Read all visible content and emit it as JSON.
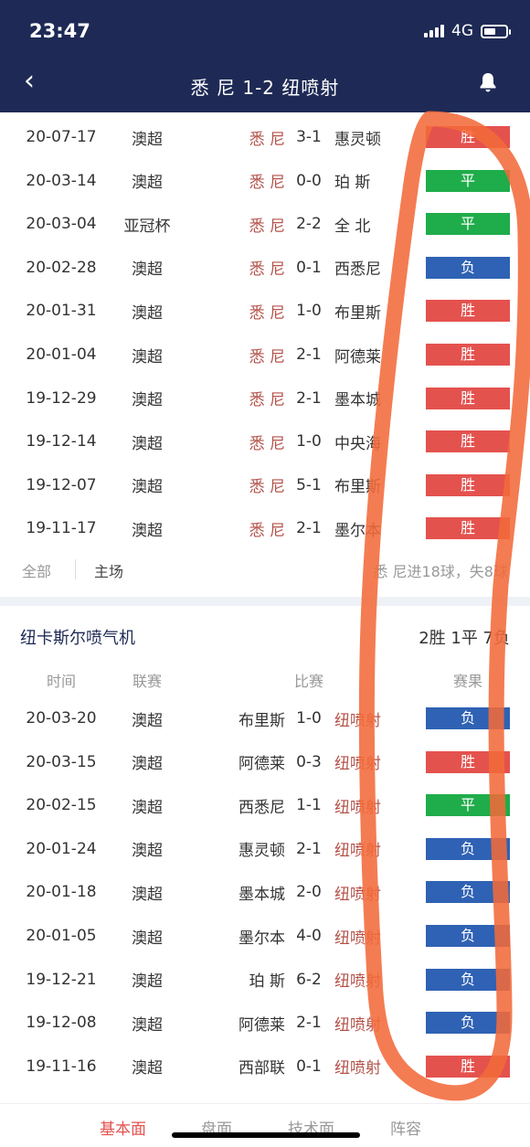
{
  "status": {
    "time": "23:47",
    "network": "4G",
    "battery_level": 0.55
  },
  "nav": {
    "title": "悉 尼    1-2    纽喷射"
  },
  "home_team": {
    "matches": [
      {
        "date": "20-07-17",
        "league": "澳超",
        "home": "悉 尼",
        "score": "3-1",
        "away": "惠灵顿",
        "result": "胜",
        "result_type": "win"
      },
      {
        "date": "20-03-14",
        "league": "澳超",
        "home": "悉 尼",
        "score": "0-0",
        "away": "珀 斯",
        "result": "平",
        "result_type": "draw"
      },
      {
        "date": "20-03-04",
        "league": "亚冠杯",
        "home": "悉 尼",
        "score": "2-2",
        "away": "全 北",
        "result": "平",
        "result_type": "draw"
      },
      {
        "date": "20-02-28",
        "league": "澳超",
        "home": "悉 尼",
        "score": "0-1",
        "away": "西悉尼",
        "result": "负",
        "result_type": "loss"
      },
      {
        "date": "20-01-31",
        "league": "澳超",
        "home": "悉 尼",
        "score": "1-0",
        "away": "布里斯",
        "result": "胜",
        "result_type": "win"
      },
      {
        "date": "20-01-04",
        "league": "澳超",
        "home": "悉 尼",
        "score": "2-1",
        "away": "阿德莱",
        "result": "胜",
        "result_type": "win"
      },
      {
        "date": "19-12-29",
        "league": "澳超",
        "home": "悉 尼",
        "score": "2-1",
        "away": "墨本城",
        "result": "胜",
        "result_type": "win"
      },
      {
        "date": "19-12-14",
        "league": "澳超",
        "home": "悉 尼",
        "score": "1-0",
        "away": "中央海",
        "result": "胜",
        "result_type": "win"
      },
      {
        "date": "19-12-07",
        "league": "澳超",
        "home": "悉 尼",
        "score": "5-1",
        "away": "布里斯",
        "result": "胜",
        "result_type": "win"
      },
      {
        "date": "19-11-17",
        "league": "澳超",
        "home": "悉 尼",
        "score": "2-1",
        "away": "墨尔本",
        "result": "胜",
        "result_type": "win"
      }
    ],
    "filter_all": "全部",
    "filter_home": "主场",
    "summary": "悉 尼进18球，失8球"
  },
  "away_team": {
    "name": "纽卡斯尔喷气机",
    "record": "2胜  1平  7负",
    "columns": {
      "time": "时间",
      "league": "联赛",
      "match": "比赛",
      "result": "赛果"
    },
    "matches": [
      {
        "date": "20-03-20",
        "league": "澳超",
        "home": "布里斯",
        "score": "1-0",
        "away": "纽喷射",
        "result": "负",
        "result_type": "loss"
      },
      {
        "date": "20-03-15",
        "league": "澳超",
        "home": "阿德莱",
        "score": "0-3",
        "away": "纽喷射",
        "result": "胜",
        "result_type": "win"
      },
      {
        "date": "20-02-15",
        "league": "澳超",
        "home": "西悉尼",
        "score": "1-1",
        "away": "纽喷射",
        "result": "平",
        "result_type": "draw"
      },
      {
        "date": "20-01-24",
        "league": "澳超",
        "home": "惠灵顿",
        "score": "2-1",
        "away": "纽喷射",
        "result": "负",
        "result_type": "loss"
      },
      {
        "date": "20-01-18",
        "league": "澳超",
        "home": "墨本城",
        "score": "2-0",
        "away": "纽喷射",
        "result": "负",
        "result_type": "loss"
      },
      {
        "date": "20-01-05",
        "league": "澳超",
        "home": "墨尔本",
        "score": "4-0",
        "away": "纽喷射",
        "result": "负",
        "result_type": "loss"
      },
      {
        "date": "19-12-21",
        "league": "澳超",
        "home": "珀 斯",
        "score": "6-2",
        "away": "纽喷射",
        "result": "负",
        "result_type": "loss"
      },
      {
        "date": "19-12-08",
        "league": "澳超",
        "home": "阿德莱",
        "score": "2-1",
        "away": "纽喷射",
        "result": "负",
        "result_type": "loss"
      },
      {
        "date": "19-11-16",
        "league": "澳超",
        "home": "西部联",
        "score": "0-1",
        "away": "纽喷射",
        "result": "胜",
        "result_type": "win"
      }
    ]
  },
  "tabs": [
    {
      "label": "基本面",
      "active": true
    },
    {
      "label": "盘面",
      "active": false
    },
    {
      "label": "技术面",
      "active": false
    },
    {
      "label": "阵容",
      "active": false
    }
  ],
  "colors": {
    "header": "#1e2a55",
    "win": "#e4524e",
    "draw": "#1fac4a",
    "loss": "#2f62b4",
    "annotation": "#f26a3a"
  }
}
